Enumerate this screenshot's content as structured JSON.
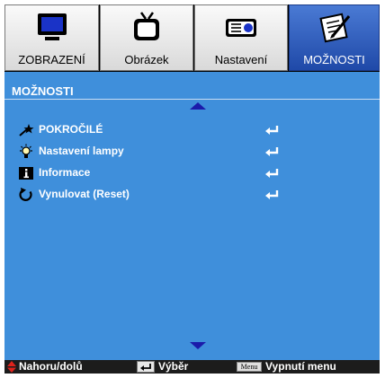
{
  "tabs": [
    {
      "label": "ZOBRAZENÍ",
      "icon": "display-icon",
      "active": false
    },
    {
      "label": "Obrázek",
      "icon": "tv-icon",
      "active": false
    },
    {
      "label": "Nastavení",
      "icon": "projector-icon",
      "active": false
    },
    {
      "label": "MOŽNOSTI",
      "icon": "options-icon",
      "active": true
    }
  ],
  "panel": {
    "title": "MOŽNOSTI",
    "items": [
      {
        "label": "POKROČILÉ",
        "icon": "advanced-icon"
      },
      {
        "label": "Nastavení lampy",
        "icon": "lamp-icon"
      },
      {
        "label": "Informace",
        "icon": "info-icon"
      },
      {
        "label": "Vynulovat (Reset)",
        "icon": "reset-icon"
      }
    ]
  },
  "footer": {
    "nav": "Nahoru/dolů",
    "select": "Výběr",
    "menu_key": "Menu",
    "exit": "Vypnutí menu"
  },
  "colors": {
    "tab_active": "#2a5bc0",
    "panel_bg": "#3f8fdb",
    "arrow": "#1b1baa",
    "footer_bg": "#1c1c1c",
    "nav_arrow": "#e0231c"
  }
}
